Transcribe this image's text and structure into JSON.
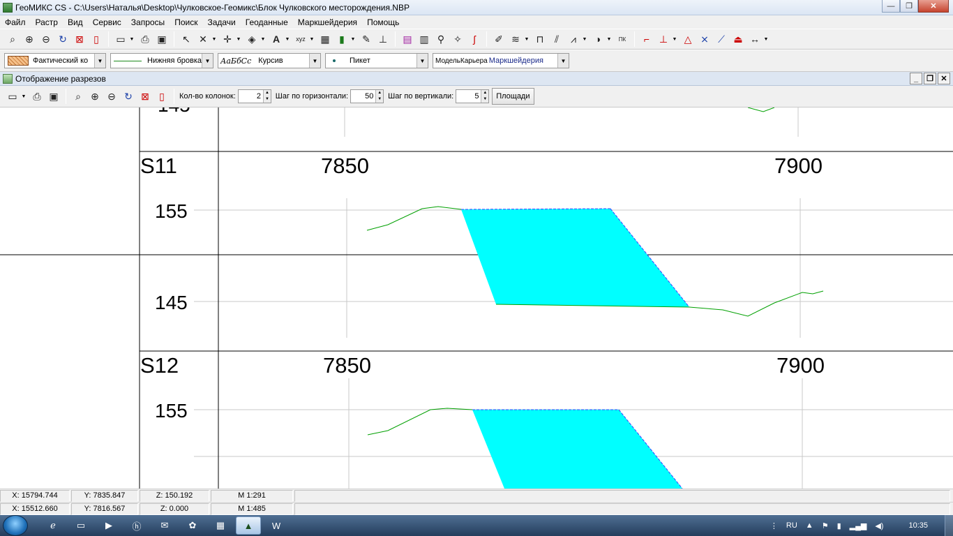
{
  "window": {
    "title": "ГеоМИКС CS - C:\\Users\\Наталья\\Desktop\\Чулковское-Геомикс\\Блок Чулковского месторождения.NBP",
    "minimize": "—",
    "maximize": "❐",
    "close": "✕"
  },
  "menu": [
    "Файл",
    "Растр",
    "Вид",
    "Сервис",
    "Запросы",
    "Поиск",
    "Задачи",
    "Геоданные",
    "Маркшейдерия",
    "Помощь"
  ],
  "toolbar2": {
    "contour_combo": "Фактический ко",
    "line_combo": "Нижняя бровка",
    "font_sample": "АаБбСс",
    "font_combo": "Курсив",
    "point_combo": "Пикет",
    "model_prefix": "МодельКарьера",
    "model_name": "Маркшейдерия"
  },
  "child_window": {
    "title": "Отображение разрезов",
    "min": "_",
    "restore": "❐",
    "close": "✕",
    "columns_label": "Кол-во колонок:",
    "columns_value": "2",
    "hstep_label": "Шаг по горизонтали:",
    "hstep_value": "50",
    "vstep_label": "Шаг по вертикали:",
    "vstep_value": "5",
    "areas_button": "Площади"
  },
  "sections": {
    "top_partial_label": "145",
    "s11": {
      "name": "S11",
      "x_labels": [
        "7850",
        "7900"
      ],
      "y_labels": [
        "155",
        "145"
      ]
    },
    "s12": {
      "name": "S12",
      "x_labels": [
        "7850",
        "7900"
      ],
      "y_labels": [
        "155"
      ]
    }
  },
  "colors": {
    "fill": "#00ffff",
    "ground_line": "#00a000",
    "design_line": "#4040ff",
    "grid": "#c8c8c8",
    "frame": "#000000"
  },
  "status": {
    "row1": {
      "x": "X: 15794.744",
      "y": "Y: 7835.847",
      "z": "Z: 150.192",
      "m": "М 1:291"
    },
    "row2": {
      "x": "X: 15512.660",
      "y": "Y: 7816.567",
      "z": "Z: 0.000",
      "m": "М 1:485"
    }
  },
  "taskbar": {
    "lang": "RU",
    "clock": "10:35"
  }
}
